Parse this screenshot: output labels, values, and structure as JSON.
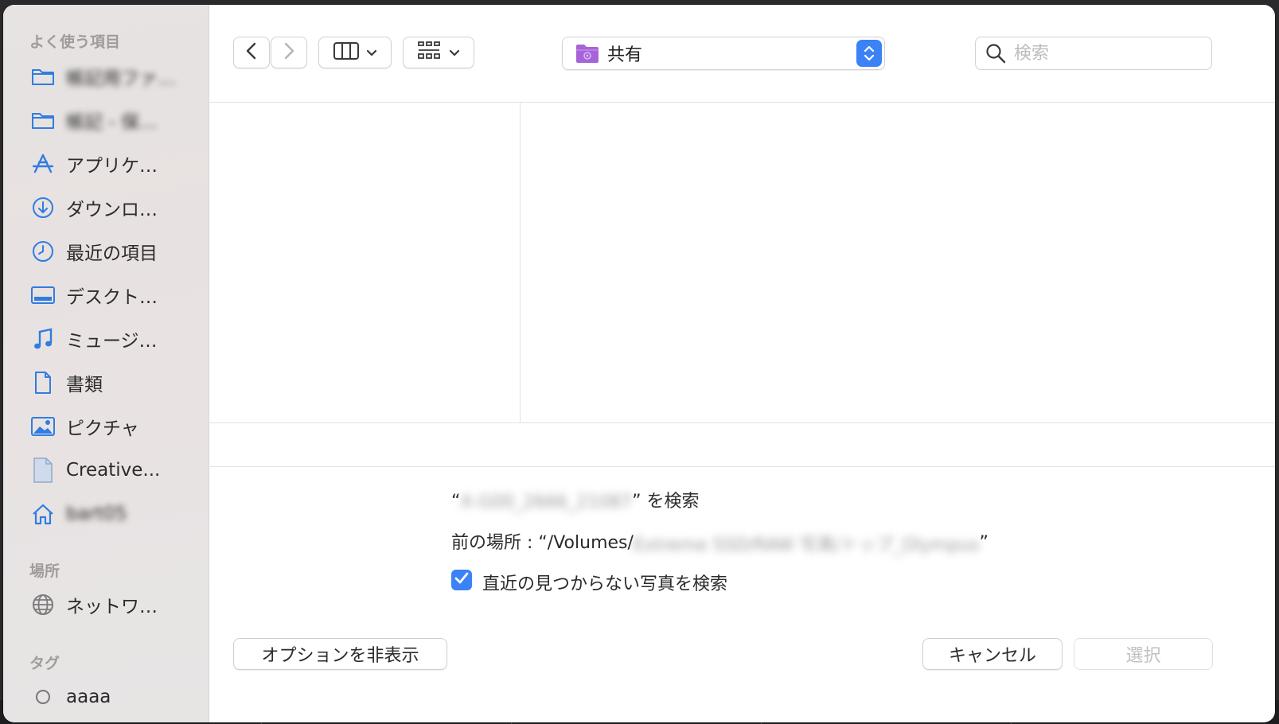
{
  "sidebar": {
    "favorites_header": "よく使う項目",
    "favorites": [
      {
        "label": "帳記用ファ…",
        "icon": "folder-icon",
        "blurred": true
      },
      {
        "label": "帳記 - 保…",
        "icon": "folder-icon",
        "blurred": true
      },
      {
        "label": "アプリケ…",
        "icon": "applications-icon",
        "blurred": false
      },
      {
        "label": "ダウンロ…",
        "icon": "download-icon",
        "blurred": false
      },
      {
        "label": "最近の項目",
        "icon": "clock-icon",
        "blurred": false
      },
      {
        "label": "デスクト…",
        "icon": "desktop-icon",
        "blurred": false
      },
      {
        "label": "ミュージ…",
        "icon": "music-icon",
        "blurred": false
      },
      {
        "label": "書類",
        "icon": "document-icon",
        "blurred": false
      },
      {
        "label": "ピクチャ",
        "icon": "pictures-icon",
        "blurred": false
      },
      {
        "label": "Creative...",
        "icon": "file-icon",
        "blurred": false
      },
      {
        "label": "bart05",
        "icon": "home-icon",
        "blurred": true
      }
    ],
    "places_header": "場所",
    "places": [
      {
        "label": "ネットワ…",
        "icon": "globe-icon"
      }
    ],
    "tags_header": "タグ",
    "tags": [
      {
        "label": "aaaa",
        "icon": "tag-circle-icon"
      }
    ]
  },
  "toolbar": {
    "location_label": "共有",
    "search_placeholder": "検索"
  },
  "options": {
    "search_prefix": "“",
    "search_blurred": "X-G00_2666_21087",
    "search_suffix": "” を検索",
    "prev_prefix": "前の場所 : “/Volumes/",
    "prev_blurred": "Extreme SSD/RAW 写真/トップ_Olympus",
    "prev_suffix": "”",
    "checkbox_label": "直近の見つからない写真を検索",
    "checkbox_checked": true
  },
  "buttons": {
    "hide_options": "オプションを非表示",
    "cancel": "キャンセル",
    "select": "選択"
  },
  "colors": {
    "accent": "#3b82f6",
    "sidebar_icon": "#2f7de1",
    "folder_purple": "#a764d8"
  }
}
